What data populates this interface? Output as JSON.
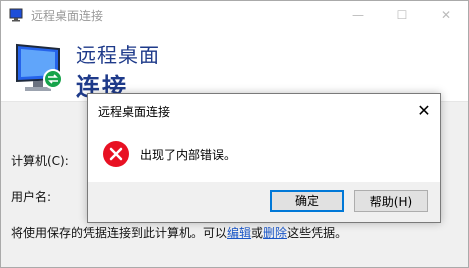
{
  "window": {
    "title": "远程桌面连接",
    "controls": {
      "minimize": "—",
      "maximize": "☐",
      "close": "✕"
    }
  },
  "header": {
    "line1": "远程桌面",
    "line2": "连接"
  },
  "form": {
    "computer_label": "计算机(C):",
    "username_label": "用户名:",
    "info_prefix": "将使用保存的凭据连接到此计算机。可以",
    "edit_link": "编辑",
    "or_text": "或",
    "delete_link": "删除",
    "info_suffix": "这些凭据。"
  },
  "dialog": {
    "title": "远程桌面连接",
    "close": "✕",
    "message": "出现了内部错误。",
    "ok_label": "确定",
    "help_label": "帮助(H)"
  },
  "colors": {
    "error_red": "#e81123",
    "accent_blue": "#0078d7",
    "header_text": "#1e3a8a"
  }
}
